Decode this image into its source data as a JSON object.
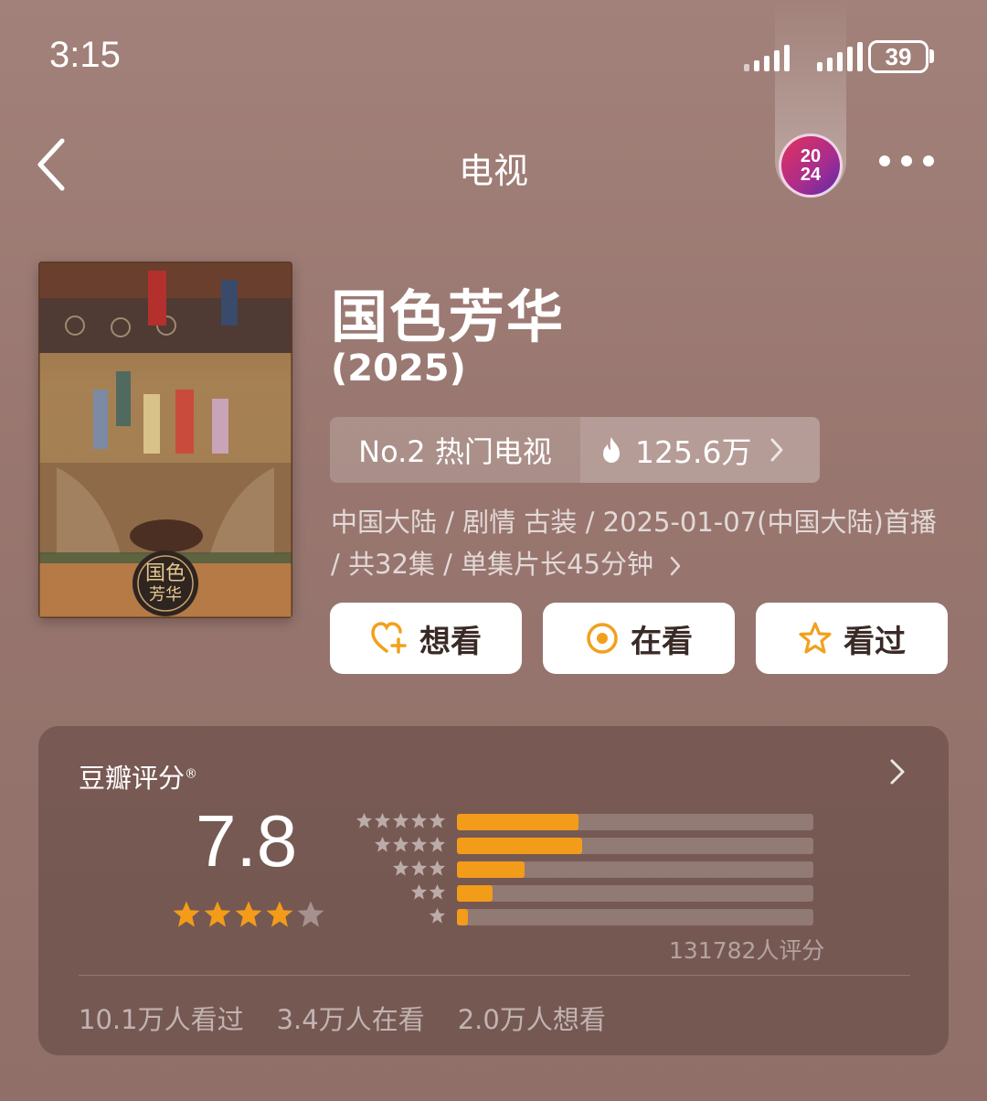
{
  "status_bar": {
    "time": "3:15",
    "battery": "39"
  },
  "nav": {
    "title": "电视",
    "badge_top": "20",
    "badge_bottom": "24"
  },
  "movie": {
    "title": "国色芳华",
    "year": "(2025)",
    "rank_label": "No.2 热门电视",
    "heat_value": "125.6万",
    "meta_line": "中国大陆 / 剧情 古装 / 2025-01-07(中国大陆)首播 / 共32集 / 单集片长45分钟"
  },
  "poster": {
    "logo_text": "国色芳华"
  },
  "actions": {
    "want": "想看",
    "watching": "在看",
    "watched": "看过"
  },
  "rating": {
    "label": "豆瓣评分",
    "mark": "®",
    "score": "7.8",
    "star_level": 4,
    "distribution": [
      {
        "stars": 5,
        "fraction": 0.34
      },
      {
        "stars": 4,
        "fraction": 0.35
      },
      {
        "stars": 3,
        "fraction": 0.19
      },
      {
        "stars": 2,
        "fraction": 0.1
      },
      {
        "stars": 1,
        "fraction": 0.03
      }
    ],
    "count": "131782人评分",
    "stats": {
      "watched": "10.1万人看过",
      "watching": "3.4万人在看",
      "want": "2.0万人想看"
    }
  },
  "colors": {
    "accent": "#f39c1a",
    "background_top": "#a2817a",
    "background_bottom": "#8f6f68"
  },
  "icons": [
    "back-icon",
    "more-icon",
    "fire-icon",
    "heart-plus-icon",
    "target-icon",
    "star-icon",
    "chevron-right-icon"
  ]
}
